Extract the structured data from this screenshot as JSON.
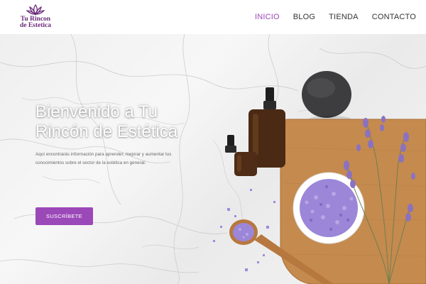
{
  "logo": {
    "line1": "Tu Rincon",
    "line2": "de Estetica",
    "icon": "lotus-icon",
    "color": "#6b2a7a"
  },
  "nav": {
    "items": [
      {
        "label": "INICIO",
        "active": true
      },
      {
        "label": "BLOG",
        "active": false
      },
      {
        "label": "TIENDA",
        "active": false
      },
      {
        "label": "CONTACTO",
        "active": false
      }
    ],
    "active_color": "#9b48b8"
  },
  "hero": {
    "title": "Bienvenido a Tu Rincón de Estética",
    "description": "Aquí encontrarás información para aprender, mejorar y aumentar tus conocimientos sobre el sector de la estética en general.",
    "cta_label": "SUSCRÍBETE",
    "accent": "#9b48b8"
  }
}
